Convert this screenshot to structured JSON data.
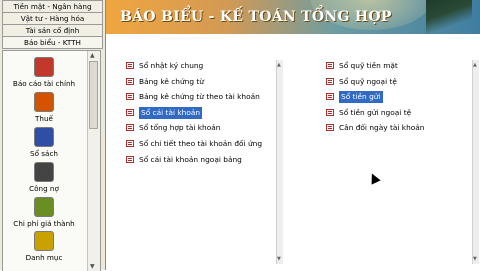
{
  "nav": {
    "tabs": [
      {
        "label": "Tiền mặt - Ngân hàng",
        "name": "tab-tien-mat"
      },
      {
        "label": "Vật tư - Hàng hóa",
        "name": "tab-vat-tu"
      },
      {
        "label": "Tài sản cố định",
        "name": "tab-tai-san"
      },
      {
        "label": "Báo biểu - KTTH",
        "name": "tab-bao-bieu"
      }
    ],
    "modules": [
      {
        "label": "Báo cáo tài chính",
        "icon": "bar-chart-icon",
        "color": "#c0392b"
      },
      {
        "label": "Thuế",
        "icon": "tax-doc-icon",
        "color": "#d35400"
      },
      {
        "label": "Sổ sách",
        "icon": "ledger-book-icon",
        "color": "#2e4fa3"
      },
      {
        "label": "Công nợ",
        "icon": "debt-chart-icon",
        "color": "#444444"
      },
      {
        "label": "Chi phí giá thành",
        "icon": "cost-icon",
        "color": "#6b8e23"
      },
      {
        "label": "Danh mục",
        "icon": "catalog-icon",
        "color": "#c9a100"
      }
    ]
  },
  "header": {
    "title": "BÁO BIỂU - KẾ TOÁN TỔNG HỢP"
  },
  "lists": {
    "left": [
      {
        "label": "Sổ nhật ký chung"
      },
      {
        "label": "Bảng kê chứng từ"
      },
      {
        "label": "Bảng kê chứng từ theo tài khoản"
      },
      {
        "label": "Sổ cái tài khoản",
        "selected": true
      },
      {
        "label": "Sổ tổng hợp tài khoản"
      },
      {
        "label": "Sổ chi tiết theo tài khoản đối ứng"
      },
      {
        "label": "Sổ cái tài khoản ngoại bảng"
      }
    ],
    "right": [
      {
        "label": "Sổ quỹ tiền mặt"
      },
      {
        "label": "Sổ quỹ ngoại tệ"
      },
      {
        "label": "Sổ tiền gửi",
        "selected": true
      },
      {
        "label": "Sổ tiền gửi ngoại tệ"
      },
      {
        "label": "Cân đối ngày tài khoản"
      }
    ]
  },
  "colors": {
    "selection": "#316ac5",
    "report_icon": "#b03030"
  }
}
